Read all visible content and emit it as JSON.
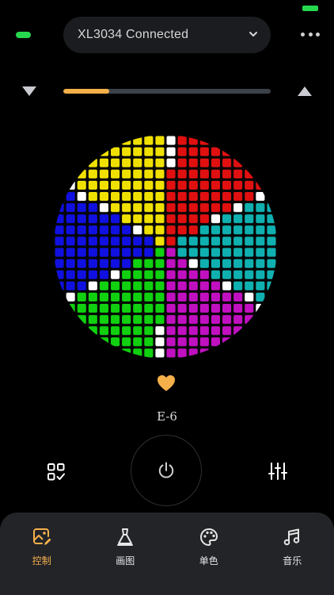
{
  "header": {
    "device_label": "XL3034 Connected"
  },
  "icons": {
    "connection": "connection-status-indicator",
    "device_chevron": "chevron-down-icon",
    "more": "more-icon",
    "brightness_down": "triangle-down-icon",
    "brightness_up": "triangle-up-icon",
    "favorite": "heart-icon",
    "mode": "grid-checklist-icon",
    "power": "power-icon",
    "equalizer": "sliders-icon"
  },
  "brightness": {
    "level": 0.22
  },
  "effect": {
    "name": "E-6"
  },
  "tabs": [
    {
      "label": "控制",
      "icon": "image-edit-icon",
      "active": true
    },
    {
      "label": "画图",
      "icon": "paint-bucket-icon",
      "active": false
    },
    {
      "label": "单色",
      "icon": "palette-icon",
      "active": false
    },
    {
      "label": "音乐",
      "icon": "music-note-icon",
      "active": false
    }
  ],
  "colors": {
    "accent": "#f5b04a",
    "connected": "#27d84f",
    "background": "#000000",
    "tabbar": "#232428",
    "led_red": "#e01010",
    "led_yellow": "#f0e000",
    "led_blue": "#1010e0",
    "led_green": "#10d010",
    "led_cyan": "#10b0b0",
    "led_magenta": "#c010c0",
    "led_white": "#ffffff"
  }
}
